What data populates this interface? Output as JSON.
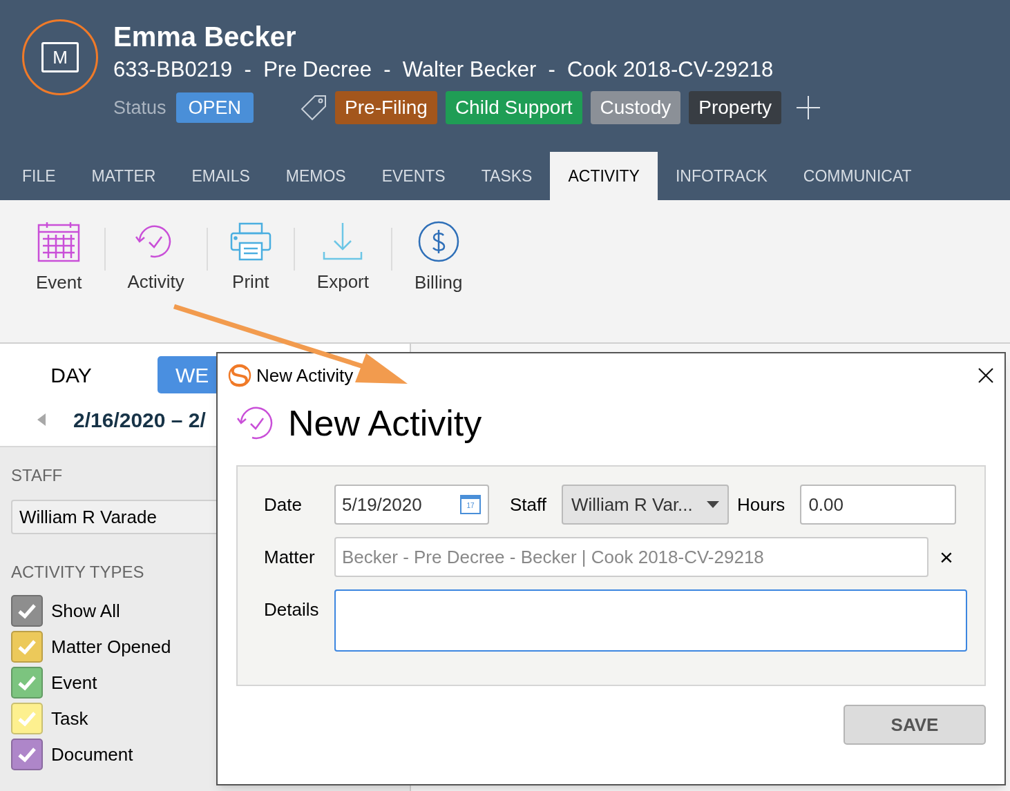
{
  "header": {
    "logo_letter": "M",
    "name": "Emma Becker",
    "subtitle": "633-BB0219  -  Pre Decree  -  Walter Becker  -  Cook 2018-CV-29218",
    "status_label": "Status",
    "status": "OPEN",
    "tags": [
      {
        "label": "Pre-Filing",
        "color": "#a3561c"
      },
      {
        "label": "Child Support",
        "color": "#1f9d55"
      },
      {
        "label": "Custody",
        "color": "#8b9097"
      },
      {
        "label": "Property",
        "color": "#383d43"
      }
    ]
  },
  "tabs": [
    {
      "label": "FILE",
      "selected": false
    },
    {
      "label": "MATTER",
      "selected": false
    },
    {
      "label": "EMAILS",
      "selected": false
    },
    {
      "label": "MEMOS",
      "selected": false
    },
    {
      "label": "EVENTS",
      "selected": false
    },
    {
      "label": "TASKS",
      "selected": false
    },
    {
      "label": "ACTIVITY",
      "selected": true
    },
    {
      "label": "INFOTRACK",
      "selected": false
    },
    {
      "label": "COMMUNICAT",
      "selected": false
    }
  ],
  "toolbar": [
    {
      "kind": "event",
      "label": "Event"
    },
    {
      "kind": "activity",
      "label": "Activity"
    },
    {
      "kind": "print",
      "label": "Print"
    },
    {
      "kind": "export",
      "label": "Export"
    },
    {
      "kind": "billing",
      "label": "Billing"
    }
  ],
  "view_tabs": [
    {
      "label": "DAY",
      "selected": false
    },
    {
      "label": "WE",
      "selected": true
    }
  ],
  "date_range": "2/16/2020 – 2/",
  "staff": {
    "heading": "STAFF",
    "value": "William R Varade"
  },
  "activity_types": {
    "heading": "ACTIVITY TYPES",
    "items": [
      {
        "label": "Show All",
        "checked": true,
        "color": "#8e8e8e"
      },
      {
        "label": "Matter Opened",
        "checked": true,
        "color": "#ecc95a"
      },
      {
        "label": "Event",
        "checked": true,
        "color": "#7cc47f"
      },
      {
        "label": "Task",
        "checked": true,
        "color": "#fdf08f"
      },
      {
        "label": "Document",
        "checked": true,
        "color": "#ae86c9"
      }
    ]
  },
  "dialog": {
    "title": "New Activity",
    "heading": "New Activity",
    "date_label": "Date",
    "date": "5/19/2020",
    "calendar_day": "17",
    "staff_label": "Staff",
    "staff": "William R Var...",
    "hours_label": "Hours",
    "hours": "0.00",
    "matter_label": "Matter",
    "matter": "Becker - Pre Decree - Becker | Cook 2018-CV-29218",
    "matter_clear": "×",
    "details_label": "Details",
    "save": "SAVE"
  }
}
